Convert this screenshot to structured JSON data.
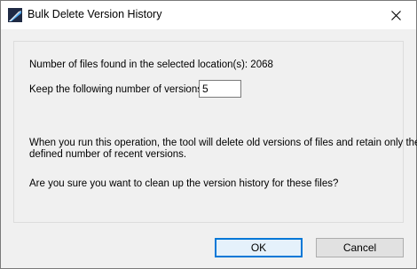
{
  "window": {
    "title": "Bulk Delete Version History",
    "close_icon": "close-icon",
    "app_icon": "app-logo-icon"
  },
  "dialog": {
    "files_found_text": "Number of files found in the selected location(s): 2068",
    "keep_versions_label": "Keep the following number of versions:",
    "keep_versions_value": "5",
    "warning_line1": "When you run this operation, the tool will delete old versions of files and retain only the",
    "warning_line2": "defined number of recent versions.",
    "confirm_question": "Are you sure you want to clean up the version history for these files?"
  },
  "buttons": {
    "ok_label": "OK",
    "cancel_label": "Cancel"
  },
  "colors": {
    "accent": "#0078d7",
    "background": "#f0f0f0",
    "icon_dark": "#1f2a44"
  }
}
